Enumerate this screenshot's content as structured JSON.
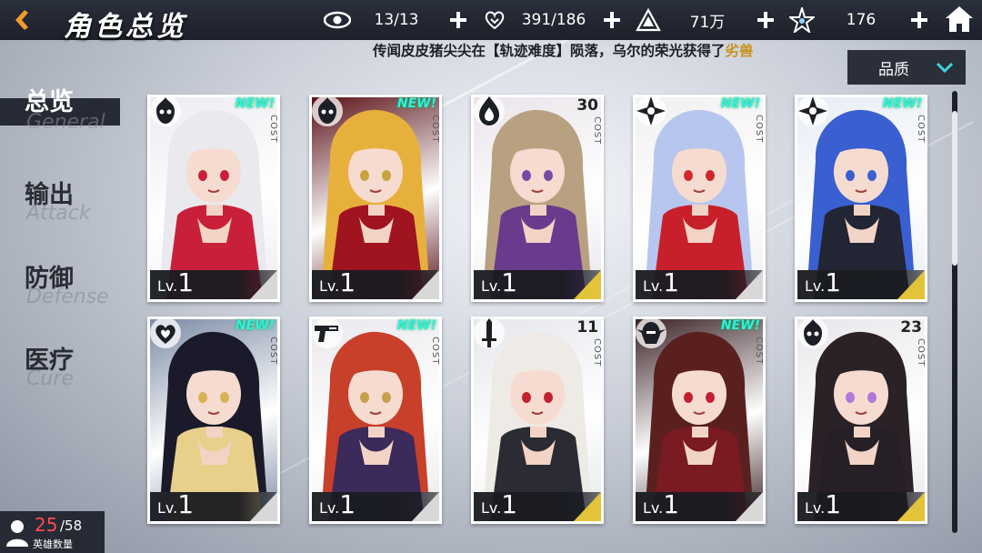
{
  "header": {
    "title": "角色总览",
    "resources": [
      {
        "icon": "eye-icon",
        "value": "13/13"
      },
      {
        "icon": "heart-hand-icon",
        "value": "391/186"
      },
      {
        "icon": "triangle-coin-icon",
        "value": "71万"
      },
      {
        "icon": "star-crystal-icon",
        "value": "176"
      }
    ]
  },
  "ticker": {
    "text": "传闻皮皮猪尖尖在【轨迹难度】陨落，乌尔的荣光获得了",
    "highlight": "劣兽"
  },
  "filter": {
    "label": "品质"
  },
  "sidebar": {
    "items": [
      {
        "cn": "总览",
        "en": "General",
        "active": true
      },
      {
        "cn": "输出",
        "en": "Attack",
        "active": false
      },
      {
        "cn": "防御",
        "en": "Defense",
        "active": false
      },
      {
        "cn": "医疗",
        "en": "Cure",
        "active": false
      }
    ]
  },
  "lv_prefix": "Lv.",
  "cost_label": "COST",
  "cards": [
    {
      "level": "1",
      "badge": "NEW!",
      "cost": "",
      "class_icon": "flame-skull-icon",
      "hair": "#e9e9ee",
      "outfit": "#c8203a",
      "bg": "#ececf2",
      "accent": "#c8203a",
      "rarity": "#d8d8d8"
    },
    {
      "level": "1",
      "badge": "NEW!",
      "cost": "",
      "class_icon": "flame-skull-icon",
      "hair": "#e7b03c",
      "outfit": "#a0141f",
      "bg": "#5a1218",
      "accent": "#c8a23a",
      "rarity": "#d8d8d8"
    },
    {
      "level": "1",
      "badge": "",
      "cost": "30",
      "class_icon": "flame-drop-icon",
      "hair": "#b8a180",
      "outfit": "#6a3a8c",
      "bg": "#e9e4ea",
      "accent": "#7a47a5",
      "rarity": "#e2c33a"
    },
    {
      "level": "1",
      "badge": "NEW!",
      "cost": "",
      "class_icon": "shuriken-icon",
      "hair": "#b7c6ee",
      "outfit": "#c8202a",
      "bg": "#f0f0f2",
      "accent": "#d0272e",
      "rarity": "#d8d8d8"
    },
    {
      "level": "1",
      "badge": "NEW!",
      "cost": "",
      "class_icon": "shuriken-icon",
      "hair": "#3a5fd0",
      "outfit": "#222533",
      "bg": "#e7ecf5",
      "accent": "#3a5fd0",
      "rarity": "#e2c33a"
    },
    {
      "level": "1",
      "badge": "NEW!",
      "cost": "",
      "class_icon": "heart-wing-icon",
      "hair": "#1a1a2a",
      "outfit": "#e8d08a",
      "bg": "#7d8ca6",
      "accent": "#d9b256",
      "rarity": "#d8d8d8"
    },
    {
      "level": "1",
      "badge": "NEW!",
      "cost": "",
      "class_icon": "pistol-icon",
      "hair": "#c8402a",
      "outfit": "#3b2a5a",
      "bg": "#e9e9ee",
      "accent": "#c8a04a",
      "rarity": "#d8d8d8"
    },
    {
      "level": "1",
      "badge": "",
      "cost": "11",
      "class_icon": "sword-icon",
      "hair": "#eeeae6",
      "outfit": "#2a2b33",
      "bg": "#e5e7ec",
      "accent": "#c02030",
      "rarity": "#e2c33a"
    },
    {
      "level": "1",
      "badge": "NEW!",
      "cost": "",
      "class_icon": "winged-helm-icon",
      "hair": "#5a2020",
      "outfit": "#7a1a22",
      "bg": "#3a2226",
      "accent": "#c21f33",
      "rarity": "#d8d8d8"
    },
    {
      "level": "1",
      "badge": "",
      "cost": "23",
      "class_icon": "flame-skull-icon",
      "hair": "#2a2226",
      "outfit": "#262026",
      "bg": "#e8e6ea",
      "accent": "#b078d8",
      "rarity": "#e2c33a"
    }
  ],
  "hero_count": {
    "current": "25",
    "max": "/58",
    "label": "英雄数量"
  }
}
